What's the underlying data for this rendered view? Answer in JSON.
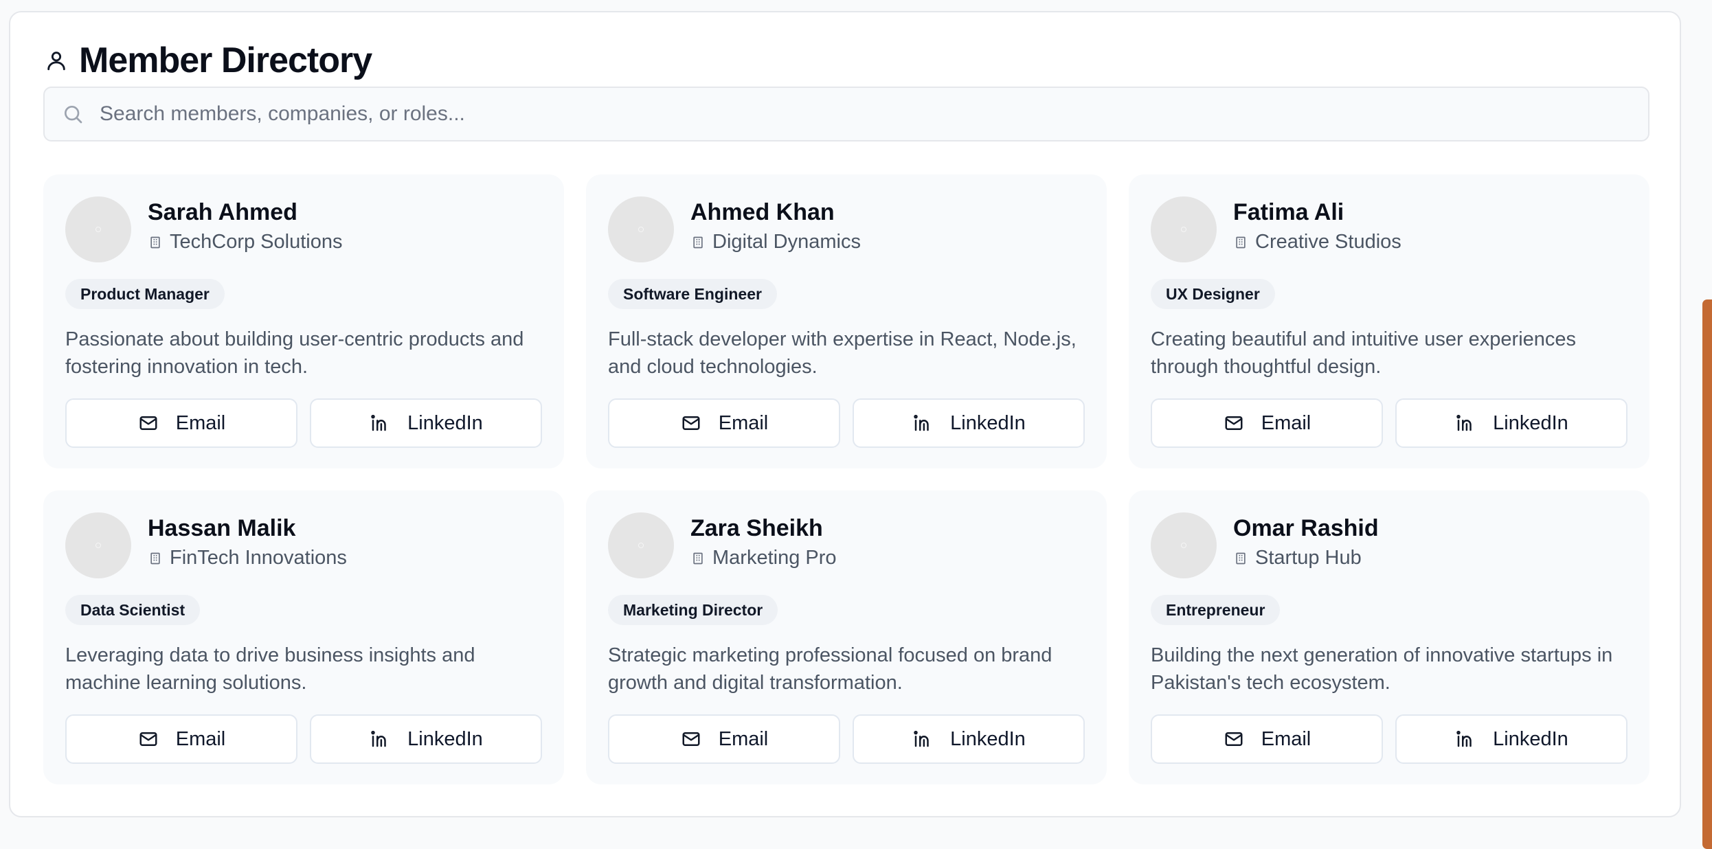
{
  "header": {
    "title": "Member Directory",
    "icon": "user-icon"
  },
  "search": {
    "placeholder": "Search members, companies, or roles...",
    "value": "",
    "icon": "search-icon"
  },
  "buttons": {
    "email_label": "Email",
    "linkedin_label": "LinkedIn"
  },
  "members": [
    {
      "name": "Sarah Ahmed",
      "company": "TechCorp Solutions",
      "role": "Product Manager",
      "bio": "Passionate about building user-centric products and fostering innovation in tech."
    },
    {
      "name": "Ahmed Khan",
      "company": "Digital Dynamics",
      "role": "Software Engineer",
      "bio": "Full-stack developer with expertise in React, Node.js, and cloud technologies."
    },
    {
      "name": "Fatima Ali",
      "company": "Creative Studios",
      "role": "UX Designer",
      "bio": "Creating beautiful and intuitive user experiences through thoughtful design."
    },
    {
      "name": "Hassan Malik",
      "company": "FinTech Innovations",
      "role": "Data Scientist",
      "bio": "Leveraging data to drive business insights and machine learning solutions."
    },
    {
      "name": "Zara Sheikh",
      "company": "Marketing Pro",
      "role": "Marketing Director",
      "bio": "Strategic marketing professional focused on brand growth and digital transformation."
    },
    {
      "name": "Omar Rashid",
      "company": "Startup Hub",
      "role": "Entrepreneur",
      "bio": "Building the next generation of innovative startups in Pakistan's tech ecosystem."
    }
  ],
  "colors": {
    "accent_scrollbar": "#c46a33",
    "card_bg": "#f8fafc",
    "badge_bg": "#eef1f5"
  }
}
